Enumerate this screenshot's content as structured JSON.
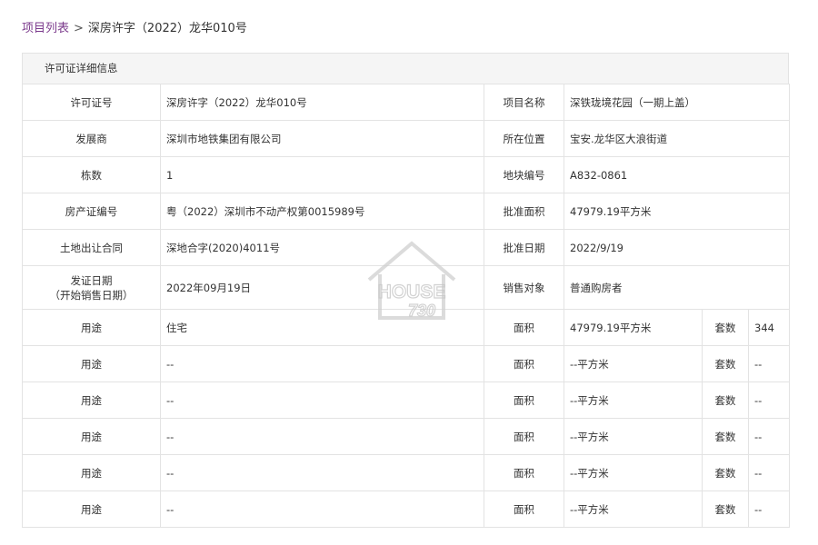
{
  "breadcrumb": {
    "parent_label": "项目列表",
    "separator": ">",
    "current_label": "深房许字（2022）龙华010号"
  },
  "panel": {
    "title": "许可证详细信息"
  },
  "details": [
    {
      "label1": "许可证号",
      "value1": "深房许字（2022）龙华010号",
      "label2": "项目名称",
      "value2": "深铁珑境花园（一期上盖）"
    },
    {
      "label1": "发展商",
      "value1": "深圳市地铁集团有限公司",
      "label2": "所在位置",
      "value2": "宝安.龙华区大浪街道"
    },
    {
      "label1": "栋数",
      "value1": "1",
      "label2": "地块编号",
      "value2": "A832-0861"
    },
    {
      "label1": "房产证编号",
      "value1": "粤（2022）深圳市不动产权第0015989号",
      "label2": "批准面积",
      "value2": "47979.19平方米"
    },
    {
      "label1": "土地出让合同",
      "value1": "深地合字(2020)4011号",
      "label2": "批准日期",
      "value2": "2022/9/19"
    }
  ],
  "issue_row": {
    "label_line1": "发证日期",
    "label_line2": "（开始销售日期）",
    "value": "2022年09月19日",
    "label2": "销售对象",
    "value2": "普通购房者"
  },
  "usage_rows": [
    {
      "usage_label": "用途",
      "usage": "住宅",
      "area_label": "面积",
      "area": "47979.19平方米",
      "units_label": "套数",
      "units": "344"
    },
    {
      "usage_label": "用途",
      "usage": "--",
      "area_label": "面积",
      "area": "--平方米",
      "units_label": "套数",
      "units": "--"
    },
    {
      "usage_label": "用途",
      "usage": "--",
      "area_label": "面积",
      "area": "--平方米",
      "units_label": "套数",
      "units": "--"
    },
    {
      "usage_label": "用途",
      "usage": "--",
      "area_label": "面积",
      "area": "--平方米",
      "units_label": "套数",
      "units": "--"
    },
    {
      "usage_label": "用途",
      "usage": "--",
      "area_label": "面积",
      "area": "--平方米",
      "units_label": "套数",
      "units": "--"
    },
    {
      "usage_label": "用途",
      "usage": "--",
      "area_label": "面积",
      "area": "--平方米",
      "units_label": "套数",
      "units": "--"
    }
  ],
  "watermark": {
    "line1": "HOUSE",
    "line2": "730",
    "color": "#c8c8c8"
  }
}
